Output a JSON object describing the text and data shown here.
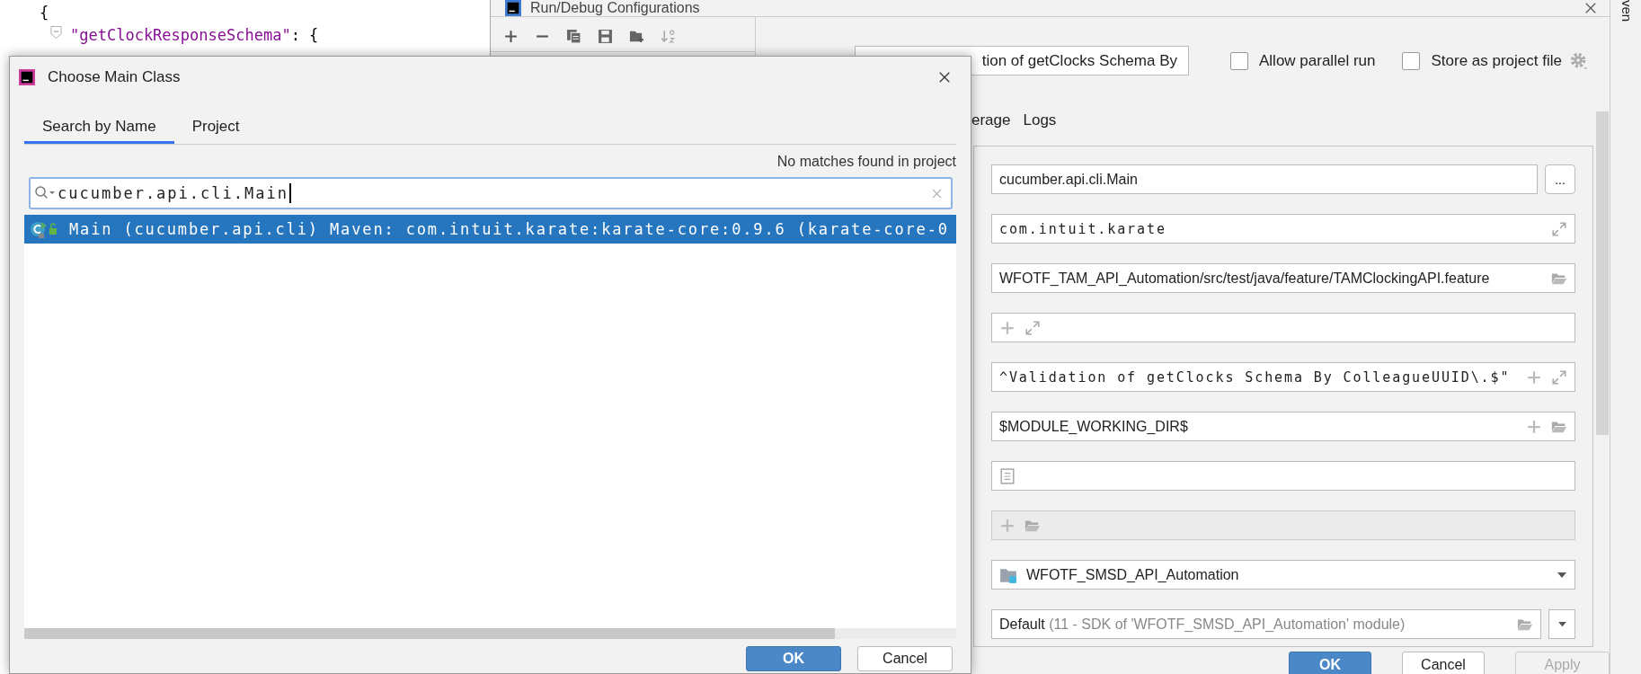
{
  "editor": {
    "lines": [
      {
        "parts": [
          {
            "kind": "punct",
            "text": "{"
          }
        ]
      },
      {
        "parts": [
          {
            "kind": "key",
            "text": "\"getClockResponseSchema\""
          },
          {
            "kind": "punct",
            "text": ": {"
          }
        ]
      }
    ]
  },
  "run_config": {
    "title": "Run/Debug Configurations",
    "name_value": "tion of getClocks Schema By",
    "checkboxes": [
      {
        "label": "Allow parallel run",
        "checked": false
      },
      {
        "label": "Store as project file",
        "checked": false
      }
    ],
    "tabs": [
      "erage",
      "Logs"
    ],
    "fields": [
      {
        "kind": "browse",
        "value": "cucumber.api.cli.Main",
        "button": "..."
      },
      {
        "kind": "mono-expand",
        "value": "com.intuit.karate"
      },
      {
        "kind": "path",
        "value": "WFOTF_TAM_API_Automation/src/test/java/feature/TAMClockingAPI.feature"
      },
      {
        "kind": "plus-expand"
      },
      {
        "kind": "mono-plus-expand",
        "value": "^Validation of getClocks Schema By ColleagueUUID\\.$\""
      },
      {
        "kind": "plus-folder",
        "value": "$MODULE_WORKING_DIR$"
      },
      {
        "kind": "doc"
      },
      {
        "kind": "disabled-plus-folder"
      },
      {
        "kind": "module",
        "value": "WFOTF_SMSD_API_Automation"
      },
      {
        "kind": "jre",
        "value": "Default",
        "hint": "(11 - SDK of 'WFOTF_SMSD_API_Automation' module)"
      }
    ],
    "buttons": [
      {
        "label": "OK",
        "kind": "primary",
        "disabled": false
      },
      {
        "label": "Cancel",
        "kind": "normal",
        "disabled": false
      },
      {
        "label": "Apply",
        "kind": "normal",
        "disabled": true
      }
    ]
  },
  "side_strip": {
    "label": "ven"
  },
  "dialog": {
    "title": "Choose Main Class",
    "tabs": [
      {
        "label": "Search by Name",
        "selected": true
      },
      {
        "label": "Project",
        "selected": false
      }
    ],
    "status": "No matches found in project",
    "search": {
      "value": "cucumber.api.cli.Main"
    },
    "results": [
      {
        "text": "Main (cucumber.api.cli) Maven: com.intuit.karate:karate-core:0.9.6 (karate-core-0",
        "selected": true
      }
    ],
    "buttons": [
      {
        "label": "OK",
        "kind": "primary"
      },
      {
        "label": "Cancel",
        "kind": "normal"
      }
    ]
  }
}
